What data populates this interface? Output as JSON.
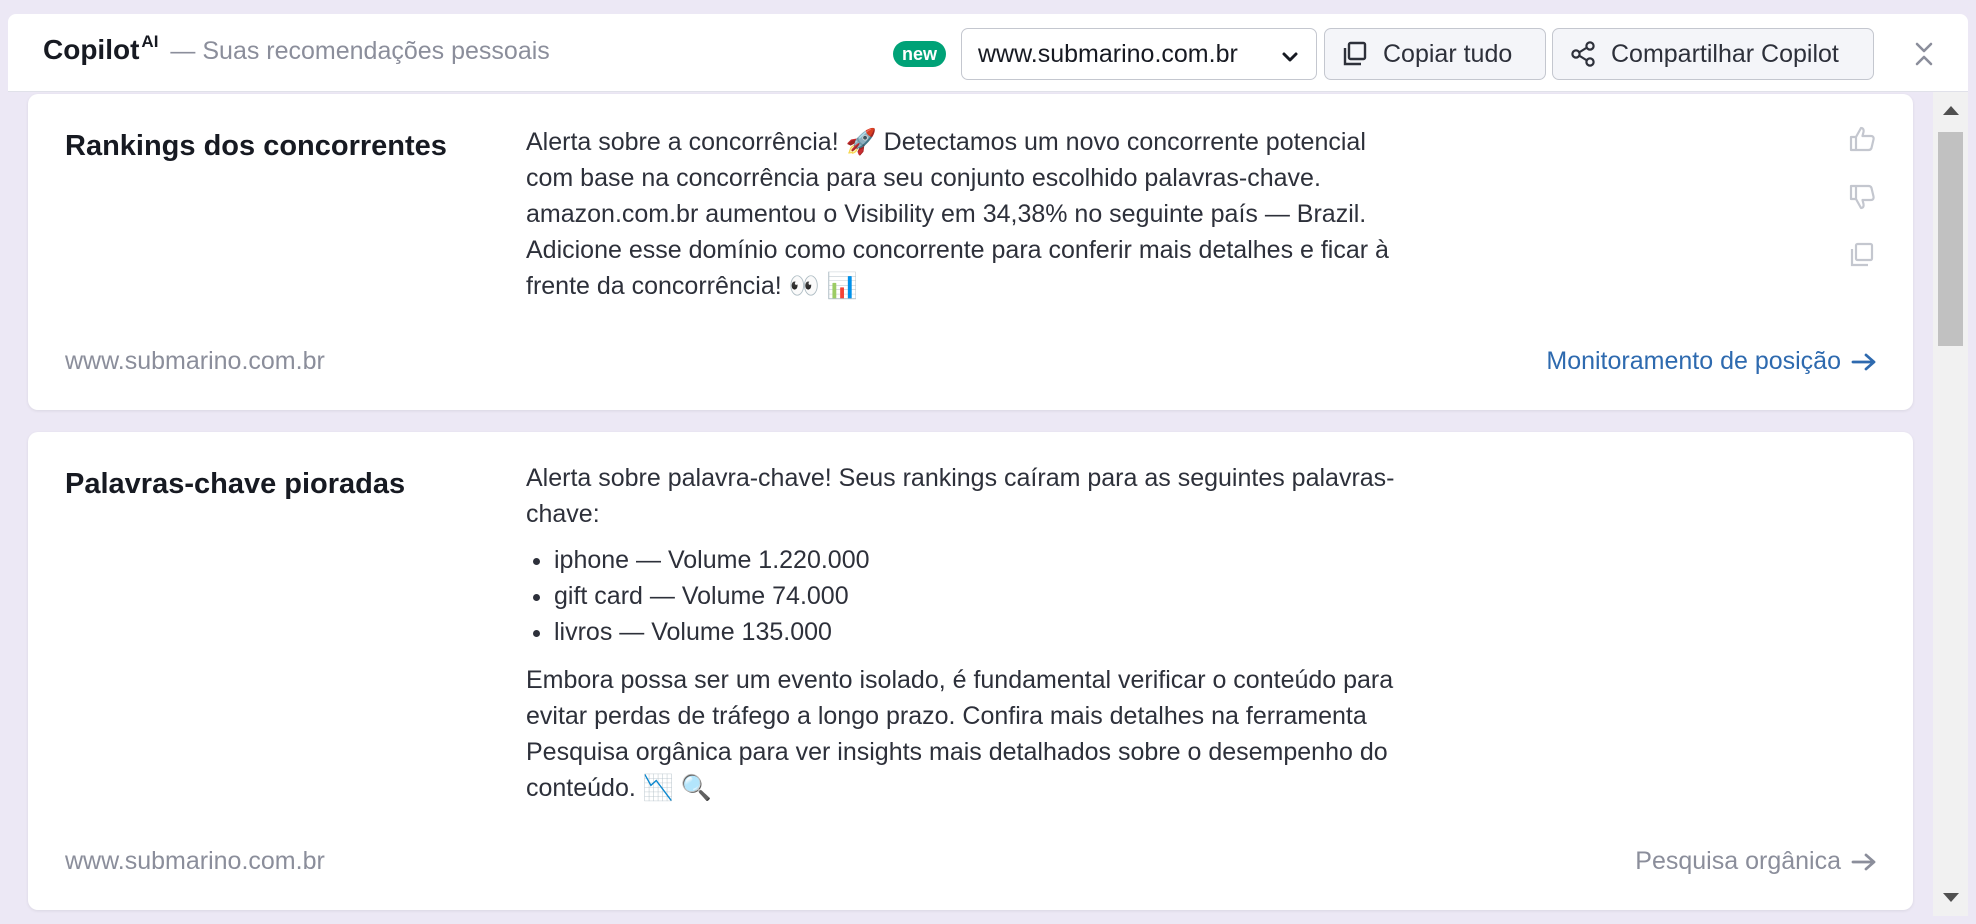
{
  "header": {
    "title": "Copilot",
    "title_sup": "AI",
    "subtitle": "— Suas recomendações pessoais",
    "badge": "new",
    "domain": "www.submarino.com.br",
    "copy_label": "Copiar tudo",
    "share_label": "Compartilhar Copilot",
    "icons": {
      "chevron": "chevron-down-icon",
      "copy": "copy-icon",
      "share": "share-icon",
      "close": "collapse-icon"
    }
  },
  "cards": [
    {
      "title": "Rankings dos concorrentes",
      "body": "Alerta sobre a concorrência! 🚀 Detectamos um novo concorrente potencial com base na concorrência para seu conjunto escolhido palavras-chave. amazon.com.br aumentou o Visibility em 34,38% no seguinte país — Brazil. Adicione esse domínio como concorrente para conferir mais detalhes e ficar à frente da concorrência! 👀 📊",
      "domain": "www.submarino.com.br",
      "link": "Monitoramento de posição"
    },
    {
      "title": "Palavras-chave pioradas",
      "intro": "Alerta sobre palavra-chave! Seus rankings caíram para as seguintes palavras-chave:",
      "keywords": [
        "iphone — Volume 1.220.000",
        "gift card — Volume 74.000",
        "livros — Volume 135.000"
      ],
      "outro": "Embora possa ser um evento isolado, é fundamental verificar o conteúdo para evitar perdas de tráfego a longo prazo. Confira mais detalhes na ferramenta Pesquisa orgânica para ver insights mais detalhados sobre o desempenho do conteúdo. 📉 🔍",
      "domain": "www.submarino.com.br",
      "link": "Pesquisa orgânica"
    }
  ],
  "colors": {
    "accent_link": "#2e6aaf",
    "badge_new": "#00a277",
    "muted_text": "#8b8e9b"
  }
}
